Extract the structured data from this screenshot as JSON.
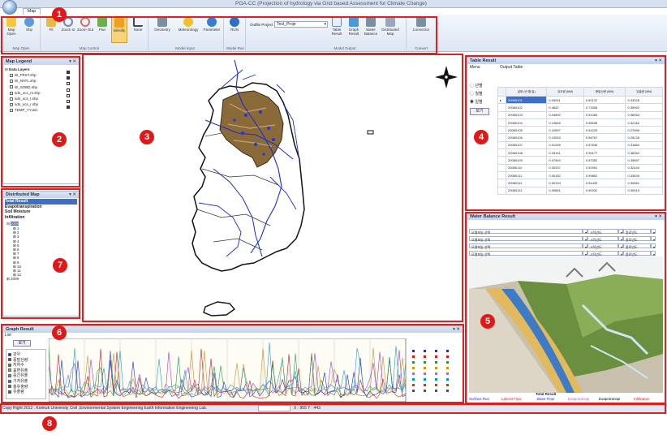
{
  "window": {
    "title": "PGA-CC (Projection of hydrology via Grid based Assessment for Climate Change)",
    "tab": "Map"
  },
  "ribbon": {
    "buttons": [
      {
        "label": "Map Open",
        "icon": "folder-open-icon"
      },
      {
        "label": "Shp",
        "icon": "globe-icon"
      },
      {
        "label": "Fit",
        "icon": "fit-icon"
      },
      {
        "label": "Zoom In",
        "icon": "zoom-in-icon"
      },
      {
        "label": "Zoom Out",
        "icon": "zoom-out-icon"
      },
      {
        "label": "Pan",
        "icon": "pan-icon"
      },
      {
        "label": "Identify",
        "icon": "identify-icon"
      },
      {
        "label": "None",
        "icon": "pointer-icon"
      },
      {
        "label": "Geometry",
        "icon": "geometry-icon"
      },
      {
        "label": "Meteorology",
        "icon": "meteorology-icon"
      },
      {
        "label": "Parameter",
        "icon": "info-icon"
      },
      {
        "label": "RUN",
        "icon": "run-icon"
      },
      {
        "label": "Table Result",
        "icon": "table-icon"
      },
      {
        "label": "Graph Result",
        "icon": "graph-icon"
      },
      {
        "label": "Water Balance",
        "icon": "water-balance-icon"
      },
      {
        "label": "Distributed Map",
        "icon": "distributed-map-icon"
      },
      {
        "label": "Connector",
        "icon": "connector-icon"
      }
    ],
    "groups": [
      "Map Open",
      "Map Control",
      "Model Input",
      "Model Run",
      "Model Output",
      "Convert"
    ],
    "outfile_label": "Outfile Project",
    "outfile_value": "Test_Proje"
  },
  "badges": [
    "1",
    "2",
    "3",
    "4",
    "5",
    "6",
    "7",
    "8"
  ],
  "map_legend": {
    "title": "Map Legend",
    "root": "Data Layers",
    "layers": [
      {
        "name": "W_FRST.shp",
        "color": "#1a2bd8"
      },
      {
        "name": "W_NATL.shp",
        "color": "#1a2bd8"
      },
      {
        "name": "W_SOBD.shp",
        "color": "#ffffff"
      },
      {
        "name": "sdn_ocs_m.shp",
        "color": "#ffffff"
      },
      {
        "name": "sdn_ocs_t.shp",
        "color": "#ffffff"
      },
      {
        "name": "sdn_ocs_r.shp",
        "color": "#ffffff"
      },
      {
        "name": "TEMP_YY.asc",
        "color": "#2b3a6a"
      }
    ]
  },
  "distributed_map": {
    "title": "Distributed Map",
    "items": [
      "Total Result",
      "Evapotranspiration",
      "Soil Moisture",
      "Infiltration"
    ],
    "years": [
      "2008",
      "2009"
    ],
    "months": [
      "1",
      "2",
      "3",
      "4",
      "5",
      "6",
      "7",
      "8",
      "9",
      "10",
      "11",
      "12"
    ]
  },
  "table_result": {
    "title": "Table Result",
    "menu": "Menu",
    "sub_title": "Output Table",
    "radios": [
      "년별",
      "월별",
      "일별"
    ],
    "button": "보기",
    "columns": [
      "날짜 (년.월.일)",
      "강우량 (MM)",
      "증발산량 (MM)",
      "유출량 (MM)"
    ],
    "rows": [
      [
        "20080101",
        "0.03041",
        "0.50137",
        "0.33328"
      ],
      [
        "20080102",
        "0.4842",
        "0.73308",
        "0.35992"
      ],
      [
        "20080103",
        "0.04892",
        "0.51065",
        "0.36063"
      ],
      [
        "20080104",
        "0.13665",
        "0.98938",
        "0.32182"
      ],
      [
        "20080105",
        "0.10597",
        "0.94233",
        "0.27666"
      ],
      [
        "20080106",
        "0.13053",
        "0.96767",
        "0.28128"
      ],
      [
        "20080107",
        "0.01269",
        "0.57636",
        "0.31664"
      ],
      [
        "20080108",
        "0.03151",
        "0.95177",
        "0.36062"
      ],
      [
        "20080109",
        "0.07540",
        "0.57052",
        "0.35897"
      ],
      [
        "20080110",
        "0.00337",
        "0.92951",
        "0.32444"
      ],
      [
        "20080111",
        "0.00182",
        "0.99852",
        "0.33649"
      ],
      [
        "20080112",
        "0.00194",
        "0.94433",
        "0.30561"
      ],
      [
        "20080113",
        "0.00861",
        "0.90032",
        "0.30919"
      ]
    ]
  },
  "water_balance": {
    "title": "Water Balance Result",
    "rows": [
      {
        "select": "모델파일 선택",
        "start": "시작년도",
        "end": "종료년도"
      },
      {
        "select": "모델파일 선택",
        "start": "시작년도",
        "end": "종료년도"
      },
      {
        "select": "모델파일 선택",
        "start": "시작년도",
        "end": "종료년도"
      },
      {
        "select": "모델파일 선택",
        "start": "시작년도",
        "end": "종료년도"
      }
    ],
    "caption": "Total Result",
    "legend": [
      "Surface Run",
      "Lateral Flow",
      "Base Flow",
      "Evapotranspi",
      "Infiltration"
    ],
    "legend_colors": [
      "#1a2bd8",
      "#d81a1a",
      "#1a2bd8",
      "#c060c0",
      "#000000",
      "#d81a1a"
    ]
  },
  "graph_result": {
    "title": "Graph Result",
    "tab": "List",
    "button": "보기",
    "list": [
      "강우",
      "증발산량",
      "지하수",
      "표면유출",
      "중간유출",
      "기저유출",
      "총유출량",
      "유출량"
    ],
    "list_colors": [
      "#1a2bd8",
      "#d81a1a",
      "#1aa01a",
      "#c0a000",
      "#c060c0",
      "#00a0a0",
      "#a05000",
      "#505050"
    ],
    "series_colors": [
      "#c02020",
      "#2030c0",
      "#20a040",
      "#d09020",
      "#a040c0",
      "#20a0c0"
    ]
  },
  "statusbar": {
    "text": "Copy Right 2012 . Konkuk University Civil ,Environmental System Engineering Earth Information Engineering Lab.",
    "coords": "X : 955 Y : 443"
  }
}
